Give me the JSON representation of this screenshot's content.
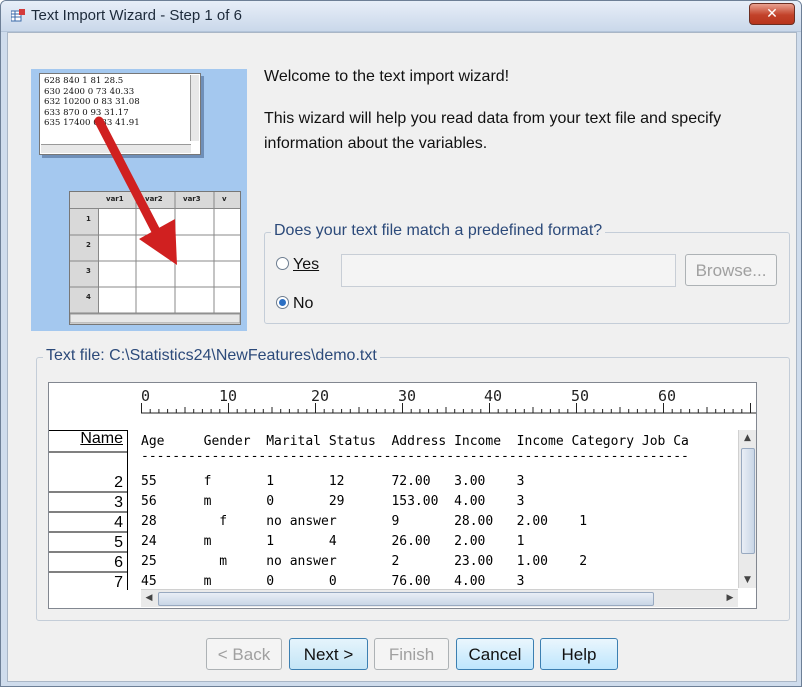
{
  "window": {
    "title": "Text Import Wizard - Step 1 of 6",
    "close_glyph": "✕"
  },
  "illustration": {
    "text_lines": [
      "628 840 1 81 28.5",
      "630 2400 0 73 40.33",
      "632 10200 0 83 31.08",
      "633 870 0 93 31.17",
      "635 17400 0 83 41.91"
    ],
    "grid_headers": [
      "var1",
      "var2",
      "var3",
      "v"
    ],
    "grid_rows": [
      "1",
      "2",
      "3",
      "4"
    ]
  },
  "welcome_text": "Welcome to the text import wizard!",
  "intro_text": "This wizard will help you read data from your text file and specify information about the variables.",
  "format_group": {
    "legend": "Does your text file match a predefined format?",
    "yes_label": "Yes",
    "no_label": "No",
    "selected": "No",
    "browse_label": "Browse..."
  },
  "file_group": {
    "legend": "Text file:  C:\\Statistics24\\NewFeatures\\demo.txt"
  },
  "ruler": {
    "ticks": [
      "0",
      "10",
      "20",
      "30",
      "40",
      "50",
      "60"
    ]
  },
  "preview": {
    "name_header": "Name",
    "row_numbers": [
      "2",
      "3",
      "4",
      "5",
      "6",
      "7"
    ],
    "header_line": "Age     Gender  Marital Status  Address Income  Income Category Job Ca",
    "separator_line": "----------------------------------------------------------------------",
    "data_lines": [
      "55      f       1       12      72.00   3.00    3",
      "56      m       0       29      153.00  4.00    3",
      "28        f     no answer       9       28.00   2.00    1",
      "24      m       1       4       26.00   2.00    1",
      "25        m     no answer       2       23.00   1.00    2",
      "45      m       0       0       76.00   4.00    3"
    ]
  },
  "buttons": {
    "back": "< Back",
    "next": "Next >",
    "finish": "Finish",
    "cancel": "Cancel",
    "help": "Help"
  },
  "colors": {
    "accent": "#2b6fc3",
    "title_bar": "#cad8ea",
    "arrow": "#d02020"
  }
}
